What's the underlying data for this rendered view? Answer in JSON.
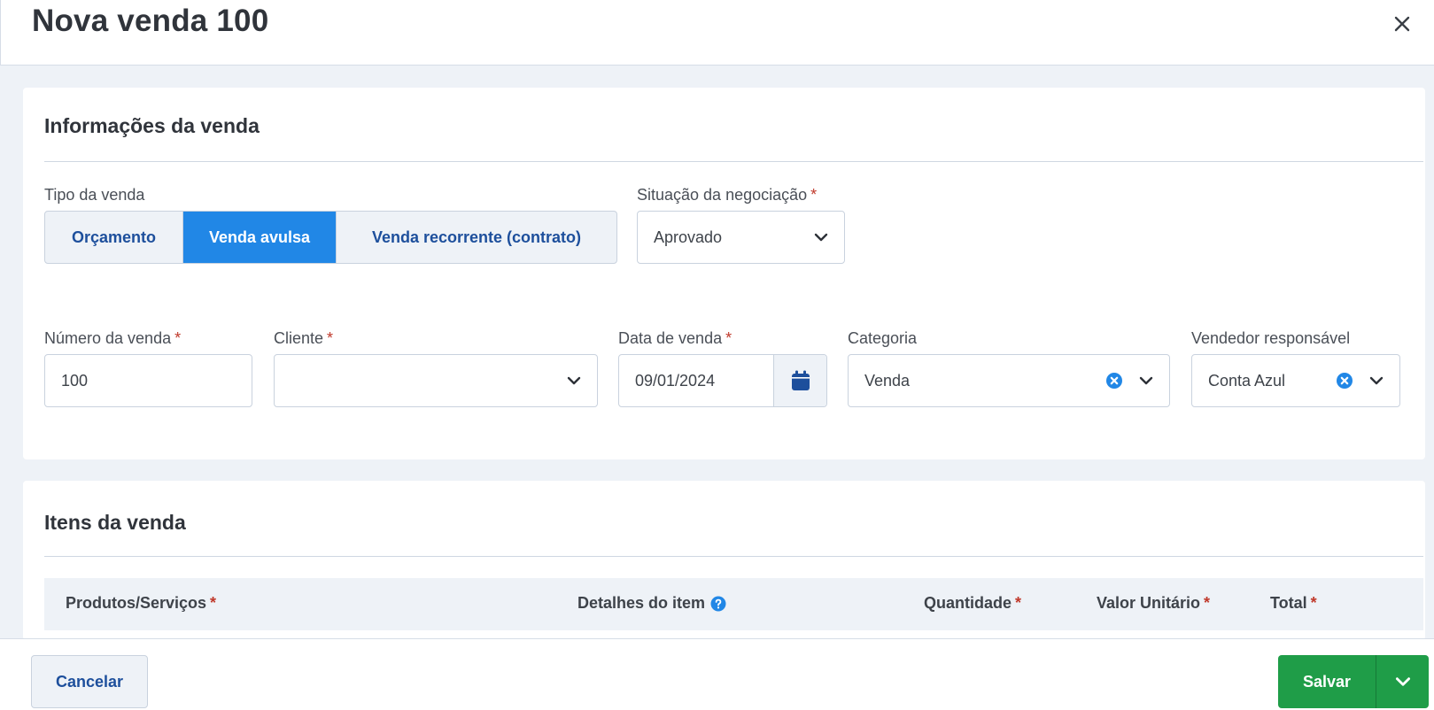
{
  "header": {
    "title": "Nova venda 100"
  },
  "info_section": {
    "title": "Informações da venda",
    "tipo_venda": {
      "label": "Tipo da venda",
      "options": [
        "Orçamento",
        "Venda avulsa",
        "Venda recorrente (contrato)"
      ],
      "selected": "Venda avulsa"
    },
    "situacao": {
      "label": "Situação da negociação",
      "required_mark": "*",
      "value": "Aprovado"
    },
    "numero": {
      "label": "Número da venda",
      "required_mark": "*",
      "value": "100"
    },
    "cliente": {
      "label": "Cliente",
      "required_mark": "*",
      "value": ""
    },
    "data": {
      "label": "Data de venda",
      "required_mark": "*",
      "value": "09/01/2024"
    },
    "categoria": {
      "label": "Categoria",
      "value": "Venda"
    },
    "vendedor": {
      "label": "Vendedor responsável",
      "value": "Conta Azul"
    }
  },
  "items_section": {
    "title": "Itens da venda",
    "columns": [
      {
        "label": "Produtos/Serviços",
        "required_mark": "*"
      },
      {
        "label": "Detalhes do item",
        "help": true
      },
      {
        "label": "Quantidade",
        "required_mark": "*"
      },
      {
        "label": "Valor Unitário",
        "required_mark": "*"
      },
      {
        "label": "Total",
        "required_mark": "*"
      }
    ]
  },
  "footer": {
    "cancel_label": "Cancelar",
    "save_label": "Salvar"
  },
  "colors": {
    "primary": "#2187e6",
    "link": "#1d4f9c",
    "success": "#1f9d48",
    "required": "#c0392b"
  },
  "icons": [
    "close-icon",
    "chevron-down-icon",
    "calendar-icon",
    "clear-icon",
    "help-icon"
  ]
}
